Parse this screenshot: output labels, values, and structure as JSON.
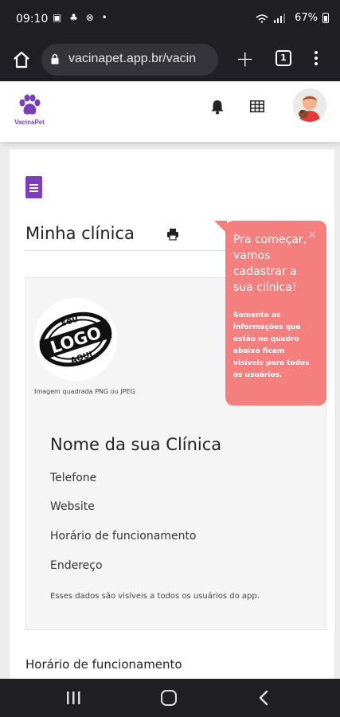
{
  "status_bar": {
    "time": "09:10",
    "notif_icons": "▣ ♣ ⊗ •",
    "battery": "67%"
  },
  "browser": {
    "url": "vacinapet.app.br/vacin",
    "tabs_count": "1"
  },
  "app_header": {
    "logo_text": "VacinaPet"
  },
  "page": {
    "title": "Minha clínica",
    "logo_badge": {
      "line1": "seu",
      "line2": "LOGO",
      "line3": "AQUI"
    },
    "logo_hint": "Imagem quadrada PNG ou JPEG",
    "clinic_name": "Nome da sua Clínica",
    "fields": [
      "Telefone",
      "Website",
      "Horário de funcionamento",
      "Endereço"
    ],
    "note": "Esses dados são visíveis a todos os usuários do app.",
    "section_title": "Horário de funcionamento"
  },
  "tooltip": {
    "title": "Pra começar, vamos cadastrar a sua clínica!",
    "body": "Somente as informações que estão no quadro abaixo ficam visíveis para todos os usuários.",
    "close": "×"
  },
  "colors": {
    "brand": "#7b3fb8",
    "tooltip_bg": "#f47f7f"
  }
}
